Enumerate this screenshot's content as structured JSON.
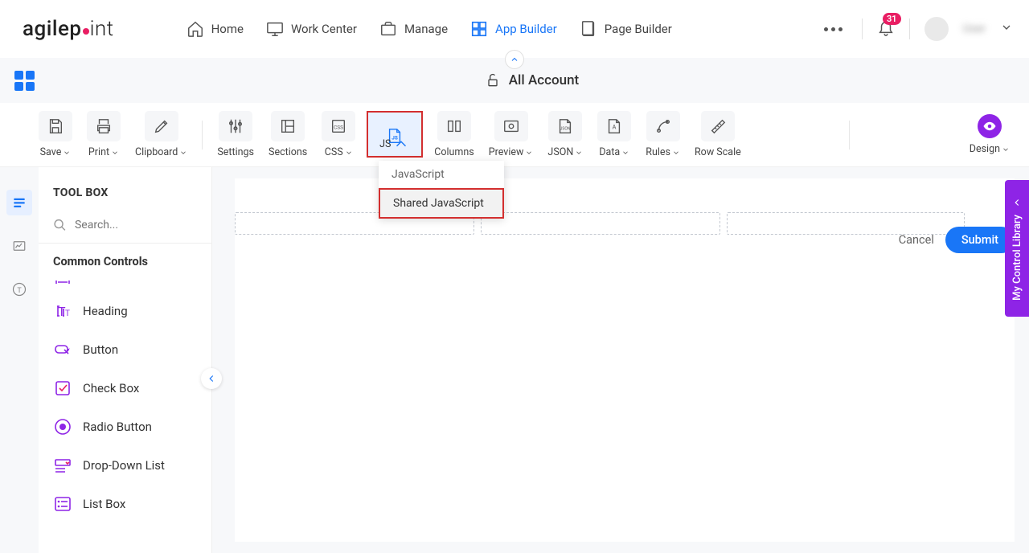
{
  "brand": "agilepoint",
  "nav": {
    "items": [
      {
        "label": "Home",
        "icon": "home"
      },
      {
        "label": "Work Center",
        "icon": "monitor"
      },
      {
        "label": "Manage",
        "icon": "briefcase"
      },
      {
        "label": "App Builder",
        "icon": "grid"
      },
      {
        "label": "Page Builder",
        "icon": "page"
      }
    ],
    "notification_count": "31",
    "user_name": "User"
  },
  "account_bar": {
    "title": "All Account"
  },
  "toolbar": {
    "save": "Save",
    "print": "Print",
    "clipboard": "Clipboard",
    "settings": "Settings",
    "sections": "Sections",
    "css": "CSS",
    "js": "JS",
    "columns": "Columns",
    "preview": "Preview",
    "json": "JSON",
    "data": "Data",
    "rules": "Rules",
    "rowscale": "Row Scale",
    "design": "Design"
  },
  "js_dropdown": {
    "item1": "JavaScript",
    "item2": "Shared JavaScript"
  },
  "toolbox": {
    "title": "TOOL BOX",
    "search_placeholder": "Search...",
    "section": "Common Controls",
    "controls": {
      "heading": "Heading",
      "button": "Button",
      "checkbox": "Check Box",
      "radio": "Radio Button",
      "dropdown": "Drop-Down List",
      "listbox": "List Box"
    }
  },
  "form": {
    "cancel": "Cancel",
    "submit": "Submit"
  },
  "control_library": "My Control Library"
}
